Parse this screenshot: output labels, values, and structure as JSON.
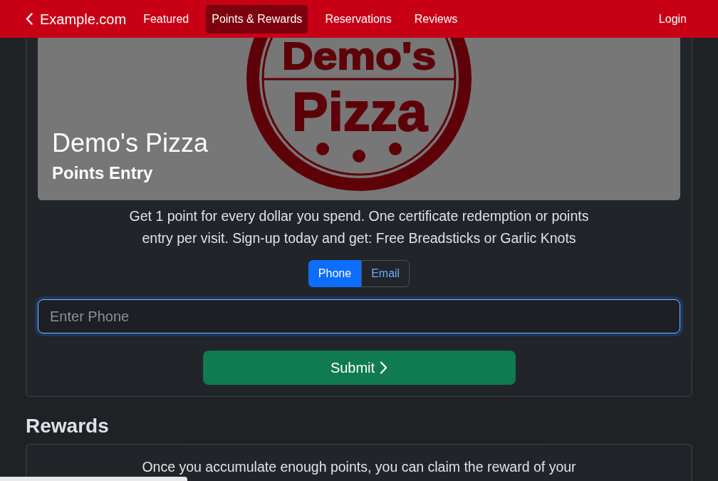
{
  "navbar": {
    "brand": "Example.com",
    "links": [
      {
        "label": "Featured",
        "selected": false
      },
      {
        "label": "Points & Rewards",
        "selected": true
      },
      {
        "label": "Reservations",
        "selected": false
      },
      {
        "label": "Reviews",
        "selected": false
      }
    ],
    "login": "Login"
  },
  "hero": {
    "logo_lines": [
      "Demo's",
      "Pizza"
    ],
    "title": "Demo's Pizza",
    "subtitle": "Points Entry"
  },
  "description": "Get 1 point for every dollar you spend. One certificate redemption or points entry per visit. Sign-up today and get: Free Breadsticks or Garlic Knots",
  "entry_mode": [
    {
      "label": "Phone",
      "selected": true
    },
    {
      "label": "Email",
      "selected": false
    }
  ],
  "phone_field": {
    "placeholder": "Enter Phone",
    "focused": true
  },
  "submit": {
    "label": "Submit"
  },
  "rewards": {
    "heading": "Rewards",
    "text": "Once you accumulate enough points, you can claim the reward of your"
  }
}
